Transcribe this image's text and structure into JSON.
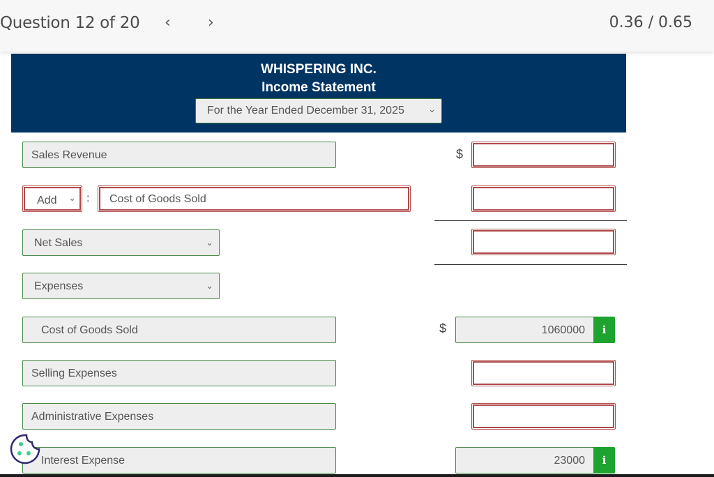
{
  "topbar": {
    "question_label": "Question 12 of 20",
    "prev_icon": "‹",
    "next_icon": "›",
    "score": "0.36 / 0.65"
  },
  "statement": {
    "company": "WHISPERING INC.",
    "title": "Income Statement",
    "period_selected": "For the Year Ended December 31, 2025"
  },
  "rows": {
    "sales_revenue": {
      "label": "Sales Revenue",
      "currency": "$",
      "amount": ""
    },
    "adjustment": {
      "operator_selected": "Add",
      "separator": ":",
      "label": "Cost of Goods Sold",
      "amount": ""
    },
    "net_sales": {
      "label": "Net Sales",
      "amount": ""
    },
    "expenses_header": {
      "label": "Expenses"
    },
    "cogs": {
      "label": "Cost of Goods Sold",
      "currency": "$",
      "amount": "1060000"
    },
    "selling": {
      "label": "Selling Expenses",
      "amount": ""
    },
    "admin": {
      "label": "Administrative Expenses",
      "amount": ""
    },
    "interest": {
      "label": "Interest Expense",
      "amount": "23000"
    }
  },
  "icons": {
    "chevron_down": "⌄",
    "info": "i"
  },
  "colors": {
    "header_bg": "#003462",
    "correct_border": "#4a8a4a",
    "incorrect_border": "#b04a4a",
    "info_button": "#1fa32f"
  }
}
